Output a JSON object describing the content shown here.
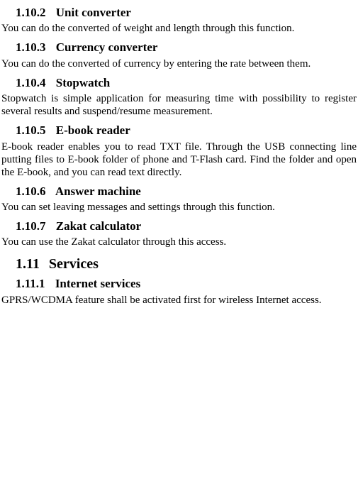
{
  "sections": [
    {
      "num": "1.10.2",
      "title": "Unit converter",
      "body": "You can do the converted of weight and length through this function."
    },
    {
      "num": "1.10.3",
      "title": "Currency converter",
      "body": "You can do the converted of currency by entering the rate between them."
    },
    {
      "num": "1.10.4",
      "title": "Stopwatch",
      "body": "Stopwatch is simple application for measuring time with possibility to register several results and suspend/resume measurement."
    },
    {
      "num": "1.10.5",
      "title": "E-book reader",
      "body": "E-book reader enables you to read TXT file. Through the USB connecting line putting files to E-book folder of phone and T-Flash card. Find the folder and open the E-book, and you can read text directly."
    },
    {
      "num": "1.10.6",
      "title": "Answer machine",
      "body": "You can set leaving messages and settings through this function."
    },
    {
      "num": "1.10.7",
      "title": "Zakat calculator",
      "body": "You can use the Zakat calculator through this access."
    }
  ],
  "h2": {
    "num": "1.11",
    "title": "Services"
  },
  "sub": {
    "num": "1.11.1",
    "title": "Internet services",
    "body": "GPRS/WCDMA feature shall be activated first for wireless Internet access."
  }
}
